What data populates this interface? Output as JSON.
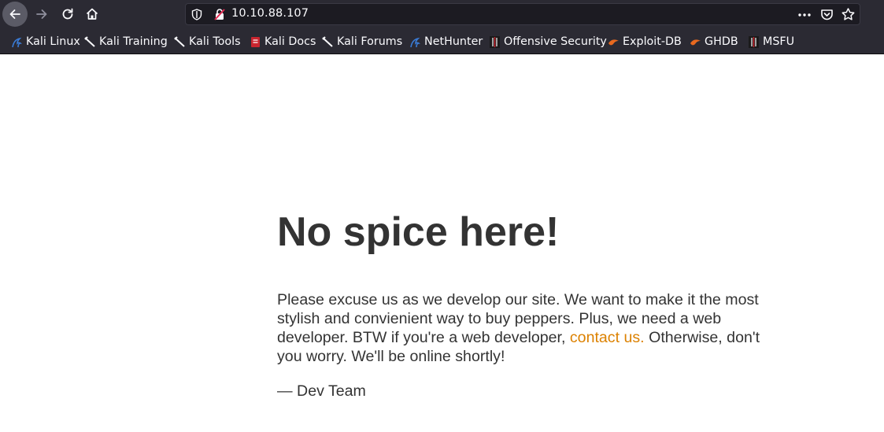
{
  "browser": {
    "url": "10.10.88.107",
    "bookmarks": [
      {
        "label": "Kali Linux",
        "icon": "kali-dragon-icon"
      },
      {
        "label": "Kali Training",
        "icon": "kali-sword-icon"
      },
      {
        "label": "Kali Tools",
        "icon": "kali-sword-icon"
      },
      {
        "label": "Kali Docs",
        "icon": "kali-docs-icon"
      },
      {
        "label": "Kali Forums",
        "icon": "kali-sword-icon"
      },
      {
        "label": "NetHunter",
        "icon": "kali-dragon-icon"
      },
      {
        "label": "Offensive Security",
        "icon": "offsec-icon"
      },
      {
        "label": "Exploit-DB",
        "icon": "exploit-db-icon"
      },
      {
        "label": "GHDB",
        "icon": "exploit-db-icon"
      },
      {
        "label": "MSFU",
        "icon": "offsec-icon"
      }
    ],
    "colors": {
      "toolbar": "#2b2a33",
      "urlbar": "#1c1b22",
      "text": "#fbfbfe"
    }
  },
  "page": {
    "heading": "No spice here!",
    "message_before_link": "Please excuse us as we develop our site. We want to make it the most stylish and convienient way to buy peppers. Plus, we need a web developer. BTW if you're a web developer, ",
    "link_text": "contact us.",
    "message_after_link": " Otherwise, don't you worry. We'll be online shortly!",
    "signature": "— Dev Team",
    "colors": {
      "text": "#333333",
      "link": "#dc8100",
      "background": "#ffffff"
    }
  }
}
